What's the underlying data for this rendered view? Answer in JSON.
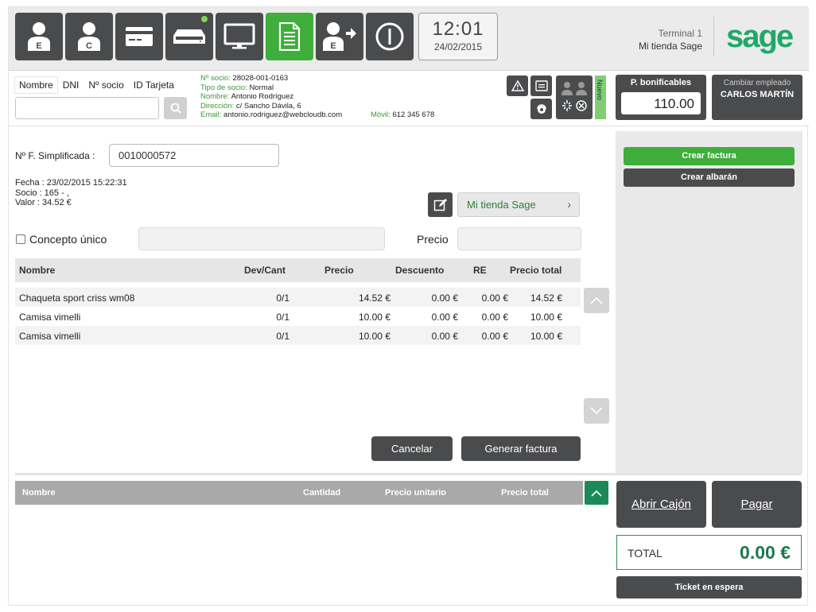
{
  "toolbar": {
    "buttons": [
      {
        "name": "employee-e",
        "icon": "person-e-icon",
        "letter": "E"
      },
      {
        "name": "customer-c",
        "icon": "person-c-icon",
        "letter": "C"
      },
      {
        "name": "card",
        "icon": "card-icon"
      },
      {
        "name": "drawer",
        "icon": "drawer-icon"
      },
      {
        "name": "monitor",
        "icon": "monitor-icon"
      },
      {
        "name": "document",
        "icon": "document-icon"
      },
      {
        "name": "employee-exit",
        "icon": "person-exit-icon",
        "letter": "E"
      },
      {
        "name": "power",
        "icon": "power-icon"
      }
    ],
    "time": "12:01",
    "date": "24/02/2015",
    "terminal": "Terminal 1",
    "store": "Mi tienda Sage",
    "logo": "sage"
  },
  "customer": {
    "tabs": [
      "Nombre",
      "DNI",
      "Nº socio",
      "ID Tarjeta"
    ],
    "info": {
      "socio_label": "Nº socio:",
      "socio": "28028-001-0163",
      "tipo_label": "Tipo de socio:",
      "tipo": "Normal",
      "nombre_label": "Nombre:",
      "nombre": "Antonio Rodríguez",
      "direccion_label": "Dirección:",
      "direccion": "c/ Sancho Dávila, 6",
      "email_label": "Email:",
      "email": "antonio.rodriguez@webcloudb.com",
      "movil_label": "Móvil:",
      "movil": "612 345 678"
    },
    "nuevo": "Nuevo",
    "points_label": "P. bonificables",
    "points": "110.00",
    "change_employee": "Cambiar empleado",
    "employee": "CARLOS MARTÍN"
  },
  "invoice": {
    "nf_label": "Nº F. Simplificada :",
    "nf_value": "0010000572",
    "fecha": "Fecha : 23/02/2015 15:22:31",
    "socio": "Socio : 165 - ,",
    "valor": "Valor : 34.52 €",
    "store_button": "Mi tienda Sage",
    "concepto_label": "Concepto único",
    "precio_label": "Precio",
    "columns": [
      "Nombre",
      "Dev/Cant",
      "Precio",
      "Descuento",
      "RE",
      "Precio total"
    ],
    "rows": [
      [
        "Chaqueta sport criss wm08",
        "0/1",
        "14.52 €",
        "0.00 €",
        "0.00 €",
        "14.52 €"
      ],
      [
        "Camisa vimelli",
        "0/1",
        "10.00 €",
        "0.00 €",
        "0.00 €",
        "10.00 €"
      ],
      [
        "Camisa vimelli",
        "0/1",
        "10.00 €",
        "0.00 €",
        "0.00 €",
        "10.00 €"
      ]
    ],
    "cancel": "Cancelar",
    "generate": "Generar factura"
  },
  "side": {
    "crear_factura": "Crear factura",
    "crear_albaran": "Crear albarán",
    "green": "#3fae3b",
    "dark": "#4a4b4d"
  },
  "ticket": {
    "columns": [
      "Nombre",
      "Cantidad",
      "Precio unitario",
      "Precio total"
    ],
    "open_drawer": "Abrir Cajón",
    "pay": "Pagar",
    "total_label": "TOTAL",
    "total": "0.00 €",
    "hold": "Ticket en espera"
  }
}
